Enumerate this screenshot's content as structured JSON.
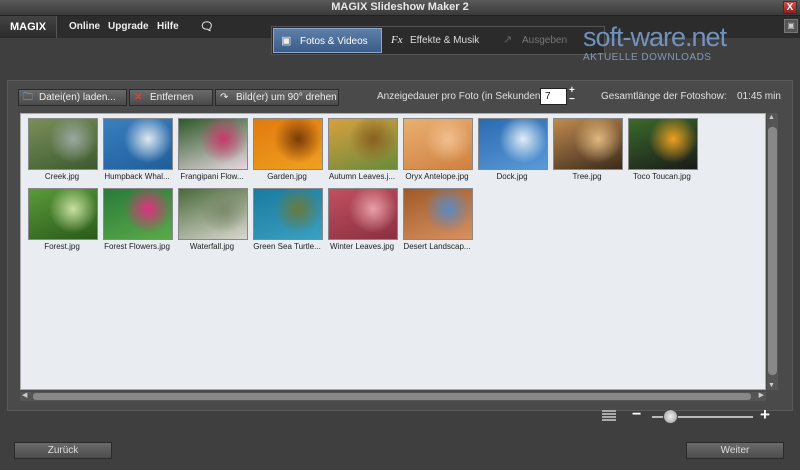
{
  "window": {
    "title": "MAGIX Slideshow Maker 2",
    "close_glyph": "X"
  },
  "menubar": {
    "logo": "MAGIX",
    "items": [
      "Online",
      "Upgrade",
      "Hilfe"
    ]
  },
  "tabs": [
    {
      "label": "Fotos & Videos",
      "active": true,
      "icon": "photo-icon"
    },
    {
      "label": "Effekte & Musik",
      "active": false,
      "icon": "fx-icon"
    },
    {
      "label": "Ausgeben",
      "active": false,
      "icon": "export-arrow-icon",
      "disabled": true
    }
  ],
  "watermark": {
    "brand": "soft-ware.net",
    "tagline": "AKTUELLE DOWNLOADS"
  },
  "toolbar": {
    "load_label": "Datei(en) laden...",
    "remove_label": "Entfernen",
    "rotate_label": "Bild(er) um 90° drehen",
    "duration_label": "Anzeigedauer pro Foto (in Sekunden):",
    "duration_value": "7",
    "total_label": "Gesamtlänge der Fotoshow:",
    "total_value": "01:45 min"
  },
  "photos": [
    {
      "caption": "Creek.jpg",
      "colors": [
        "#7a8f5a",
        "#3c5a2e",
        "#9aa8a0"
      ]
    },
    {
      "caption": "Humpback Whal...",
      "colors": [
        "#3a7fc0",
        "#1f5e9a",
        "#dfe8f0"
      ]
    },
    {
      "caption": "Frangipani Flow...",
      "colors": [
        "#2e5a2a",
        "#e8d8e0",
        "#c83a6a"
      ]
    },
    {
      "caption": "Garden.jpg",
      "colors": [
        "#e07a10",
        "#f0a020",
        "#7a3a08"
      ]
    },
    {
      "caption": "Autumn Leaves.j...",
      "colors": [
        "#d8a040",
        "#6a8a3a",
        "#8a6020"
      ]
    },
    {
      "caption": "Oryx Antelope.jpg",
      "colors": [
        "#e8b070",
        "#d08040",
        "#f0c090"
      ]
    },
    {
      "caption": "Dock.jpg",
      "colors": [
        "#2a6ab0",
        "#5a9ad8",
        "#e0eef8"
      ]
    },
    {
      "caption": "Tree.jpg",
      "colors": [
        "#c08a50",
        "#3a2a1a",
        "#e0b880"
      ]
    },
    {
      "caption": "Toco Toucan.jpg",
      "colors": [
        "#3a6a2a",
        "#1a1a1a",
        "#f0a020"
      ]
    },
    {
      "caption": "Forest.jpg",
      "colors": [
        "#5a9a3a",
        "#2a5a1a",
        "#c8e0a0"
      ]
    },
    {
      "caption": "Forest Flowers.jpg",
      "colors": [
        "#2a7a3a",
        "#5aaa4a",
        "#e03080"
      ]
    },
    {
      "caption": "Waterfall.jpg",
      "colors": [
        "#4a6a3a",
        "#dad8d0",
        "#7a8a6a"
      ]
    },
    {
      "caption": "Green Sea Turtle...",
      "colors": [
        "#1a7aa0",
        "#3aa0c0",
        "#6a7a3a"
      ]
    },
    {
      "caption": "Winter Leaves.jpg",
      "colors": [
        "#c05060",
        "#8a3040",
        "#e8a0a8"
      ]
    },
    {
      "caption": "Desert Landscap...",
      "colors": [
        "#a05a2a",
        "#d89060",
        "#5a8ac0"
      ]
    }
  ],
  "footer": {
    "back_label": "Zurück",
    "next_label": "Weiter"
  },
  "zoom": {
    "minus": "−",
    "plus": "+",
    "level": 0.18
  }
}
